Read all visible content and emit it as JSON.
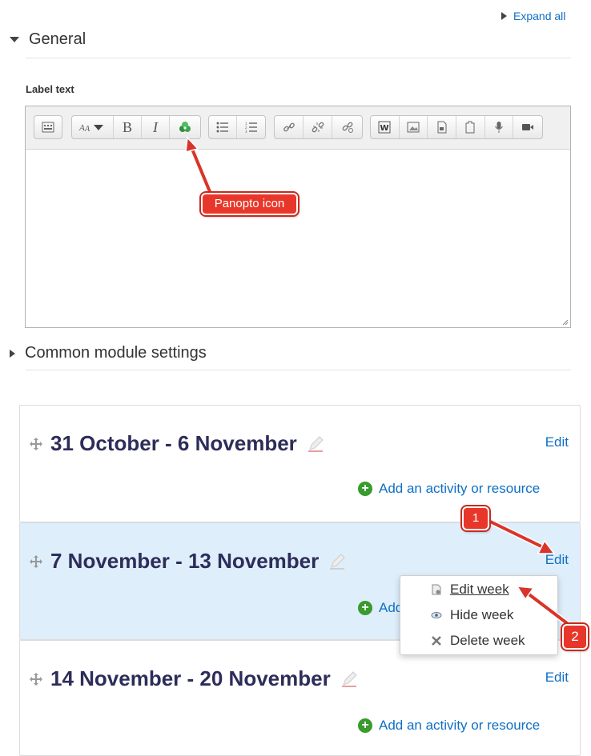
{
  "header": {
    "expand_all": "Expand all"
  },
  "sections": {
    "general": "General",
    "common": "Common module settings"
  },
  "editor": {
    "label": "Label text",
    "toolbar_icons": [
      "show-more-icon",
      "font-style-icon",
      "bold-icon",
      "italic-icon",
      "panopto-icon",
      "unordered-list-icon",
      "ordered-list-icon",
      "link-icon",
      "unlink-icon",
      "emoticon-icon",
      "word-import-icon",
      "image-icon",
      "media-icon",
      "manage-files-icon",
      "record-audio-icon",
      "record-video-icon"
    ],
    "bold": "B",
    "italic": "I"
  },
  "annotations": {
    "panopto": "Panopto icon",
    "step1": "1",
    "step2": "2"
  },
  "weeks": [
    {
      "title": "31 October - 6 November",
      "edit": "Edit",
      "add": "Add an activity or resource"
    },
    {
      "title": "7 November - 13 November",
      "edit": "Edit",
      "add": "Add an activity or resource"
    },
    {
      "title": "14 November - 20 November",
      "edit": "Edit",
      "add": "Add an activity or resource"
    }
  ],
  "week2_add_visible": "Add",
  "menu": {
    "edit_week": "Edit week",
    "hide_week": "Hide week",
    "delete_week": "Delete week"
  },
  "colors": {
    "link": "#0f6fc5",
    "week_title": "#2d2d5a",
    "highlight": "#deeefa",
    "callout": "#e8372a",
    "plus": "#3a9a2e"
  }
}
